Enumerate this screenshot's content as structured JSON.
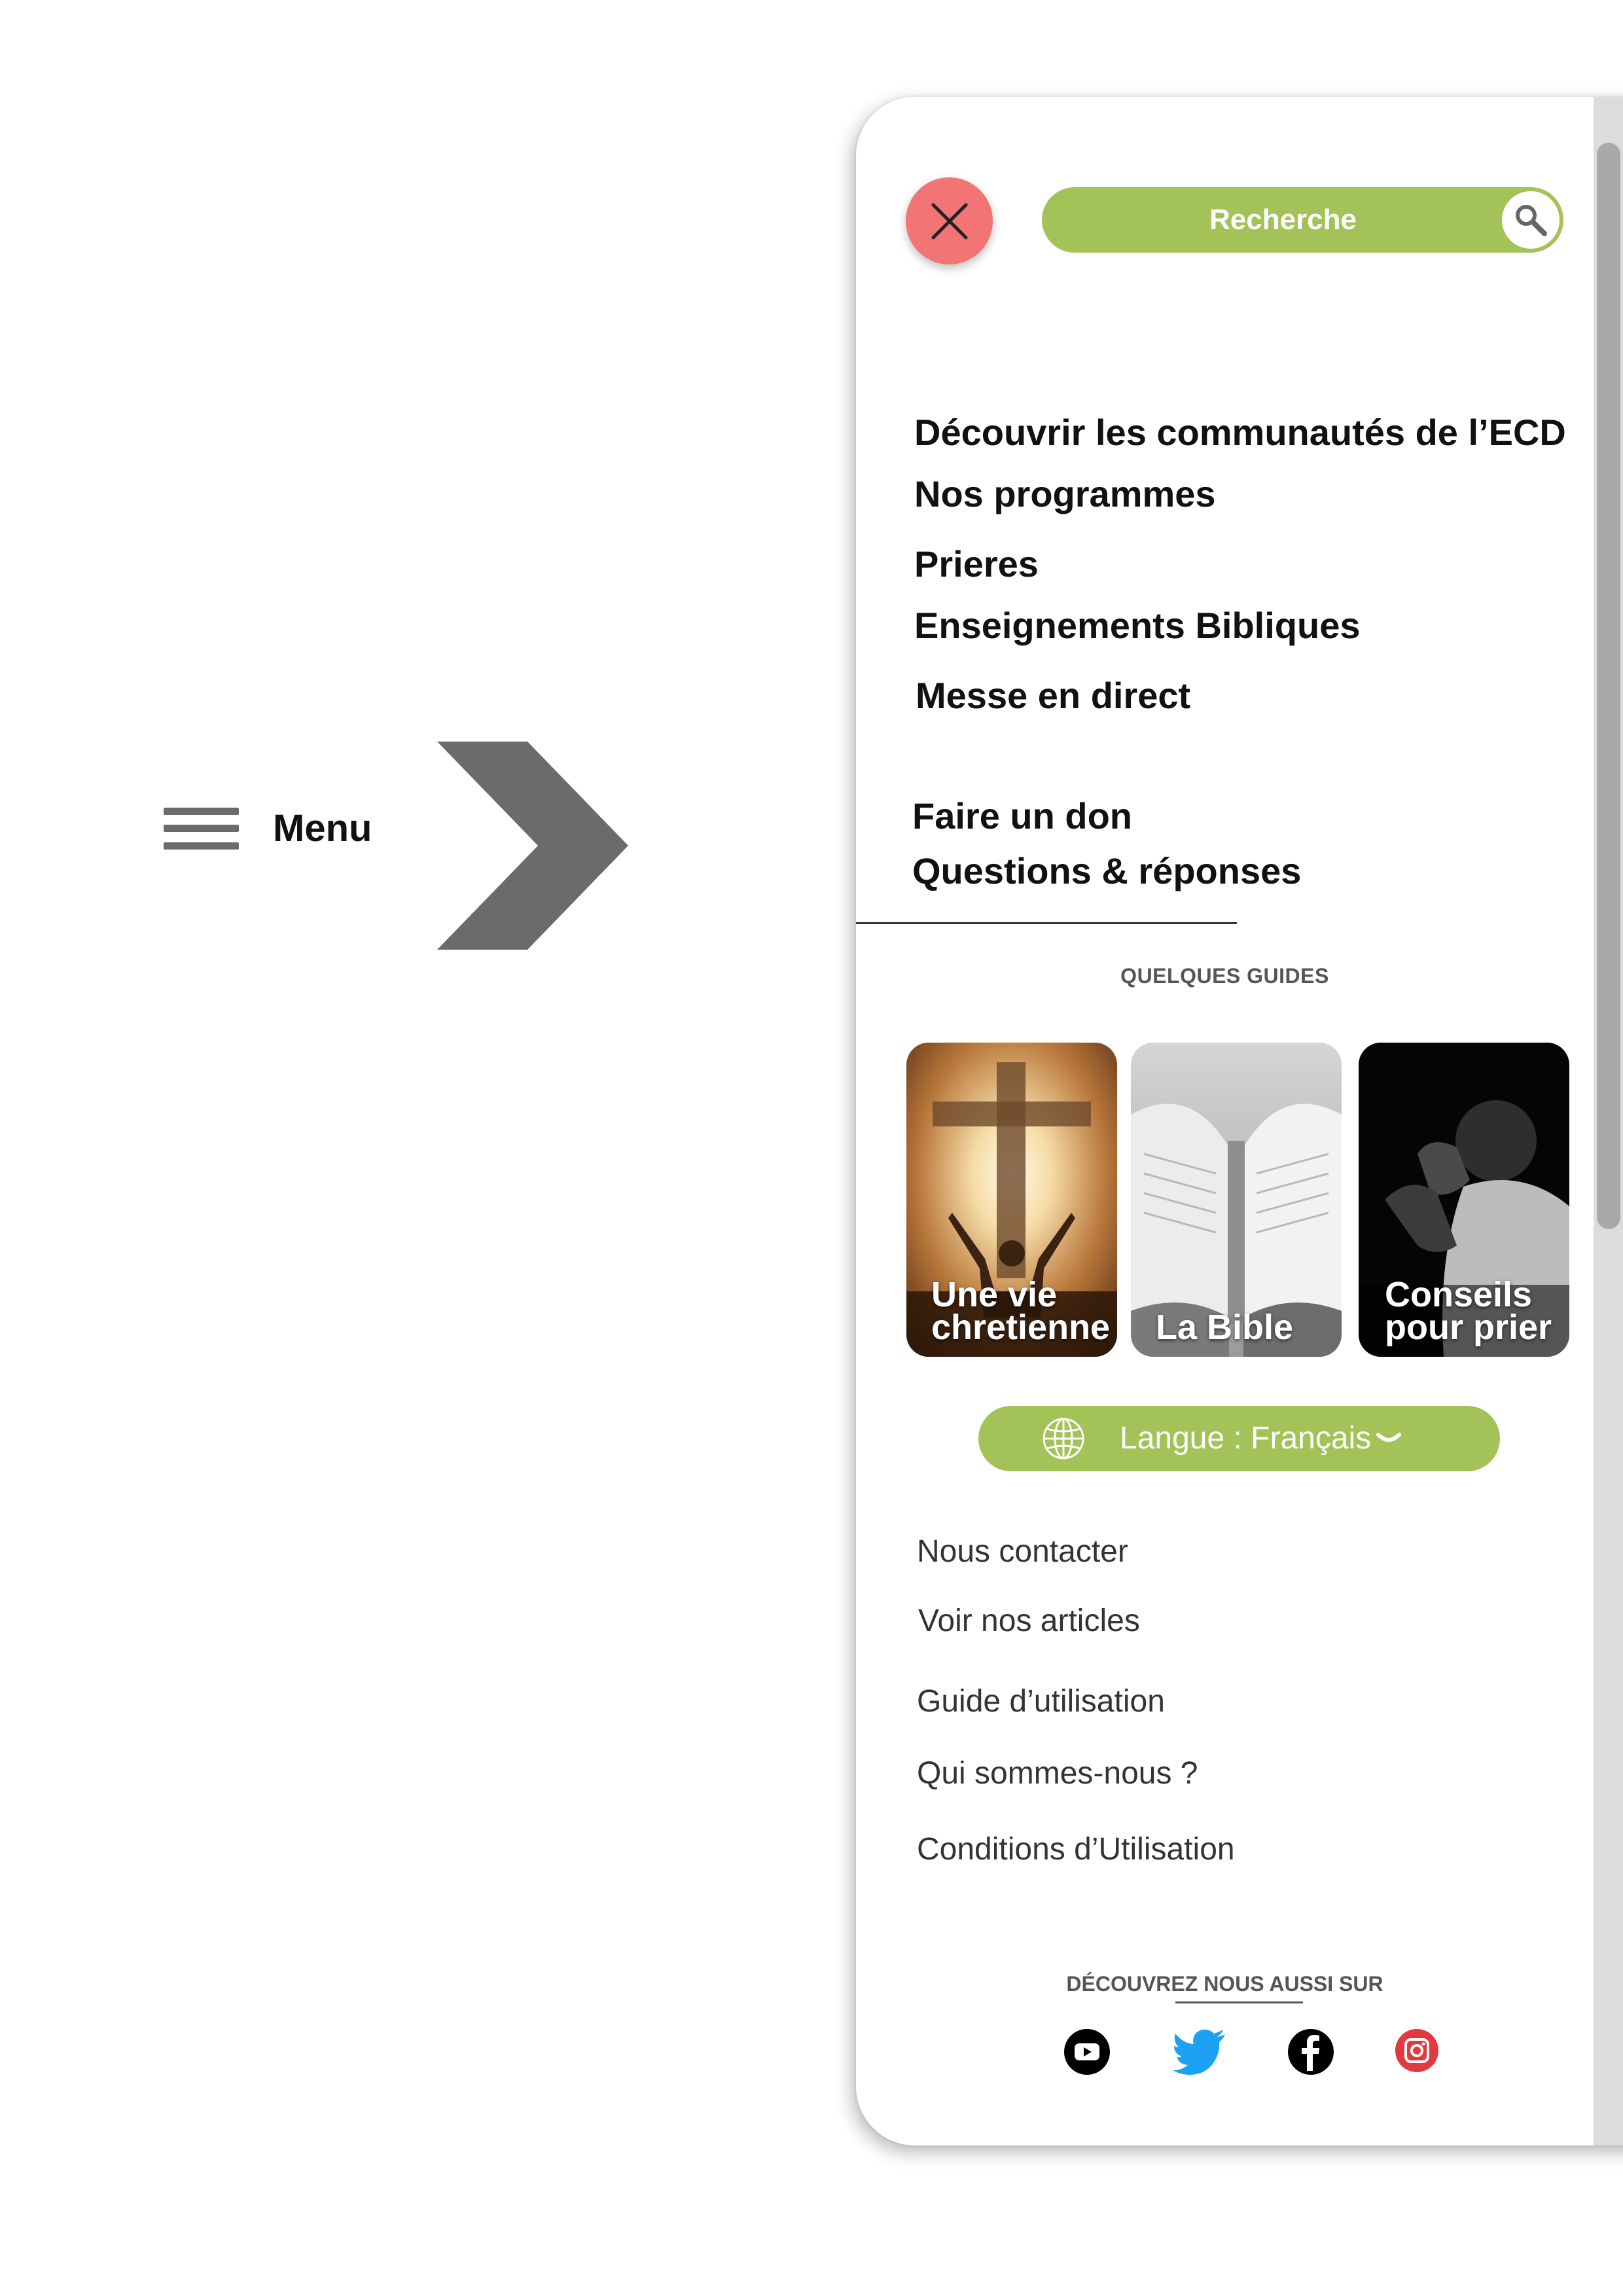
{
  "trigger": {
    "label": "Menu"
  },
  "search": {
    "placeholder": "Recherche"
  },
  "nav": {
    "primary": [
      {
        "label": "Découvrir les communautés  de l’ECD"
      },
      {
        "label": "Nos programmes"
      },
      {
        "label": "Prieres"
      },
      {
        "label": "Enseignements Bibliques"
      },
      {
        "label": "Messe en direct"
      }
    ],
    "secondary": [
      {
        "label": "Faire un don"
      },
      {
        "label": "Questions & réponses"
      }
    ]
  },
  "guides": {
    "heading": "QUELQUES GUIDES",
    "cards": [
      {
        "title": "Une vie\nchretienne",
        "image": "cross-sunset-image"
      },
      {
        "title": "La Bible",
        "image": "open-bible-image"
      },
      {
        "title": "Conseils\npour prier",
        "image": "man-praying-image"
      }
    ]
  },
  "language": {
    "label": "Langue : Français"
  },
  "footer_links": [
    {
      "label": "Nous contacter"
    },
    {
      "label": "Voir nos articles"
    },
    {
      "label": "Guide d’utilisation"
    },
    {
      "label": "Qui sommes-nous ?"
    },
    {
      "label": "Conditions d’Utilisation"
    }
  ],
  "social": {
    "heading": "DÉCOUVREZ NOUS AUSSI SUR",
    "networks": [
      "youtube-icon",
      "twitter-icon",
      "facebook-icon",
      "instagram-icon"
    ]
  },
  "colors": {
    "accent_green": "#a3c257",
    "close_red": "#f27474",
    "arrow_gray": "#6b6b6b",
    "twitter_blue": "#1da1f2",
    "instagram_red": "#e1393f"
  }
}
